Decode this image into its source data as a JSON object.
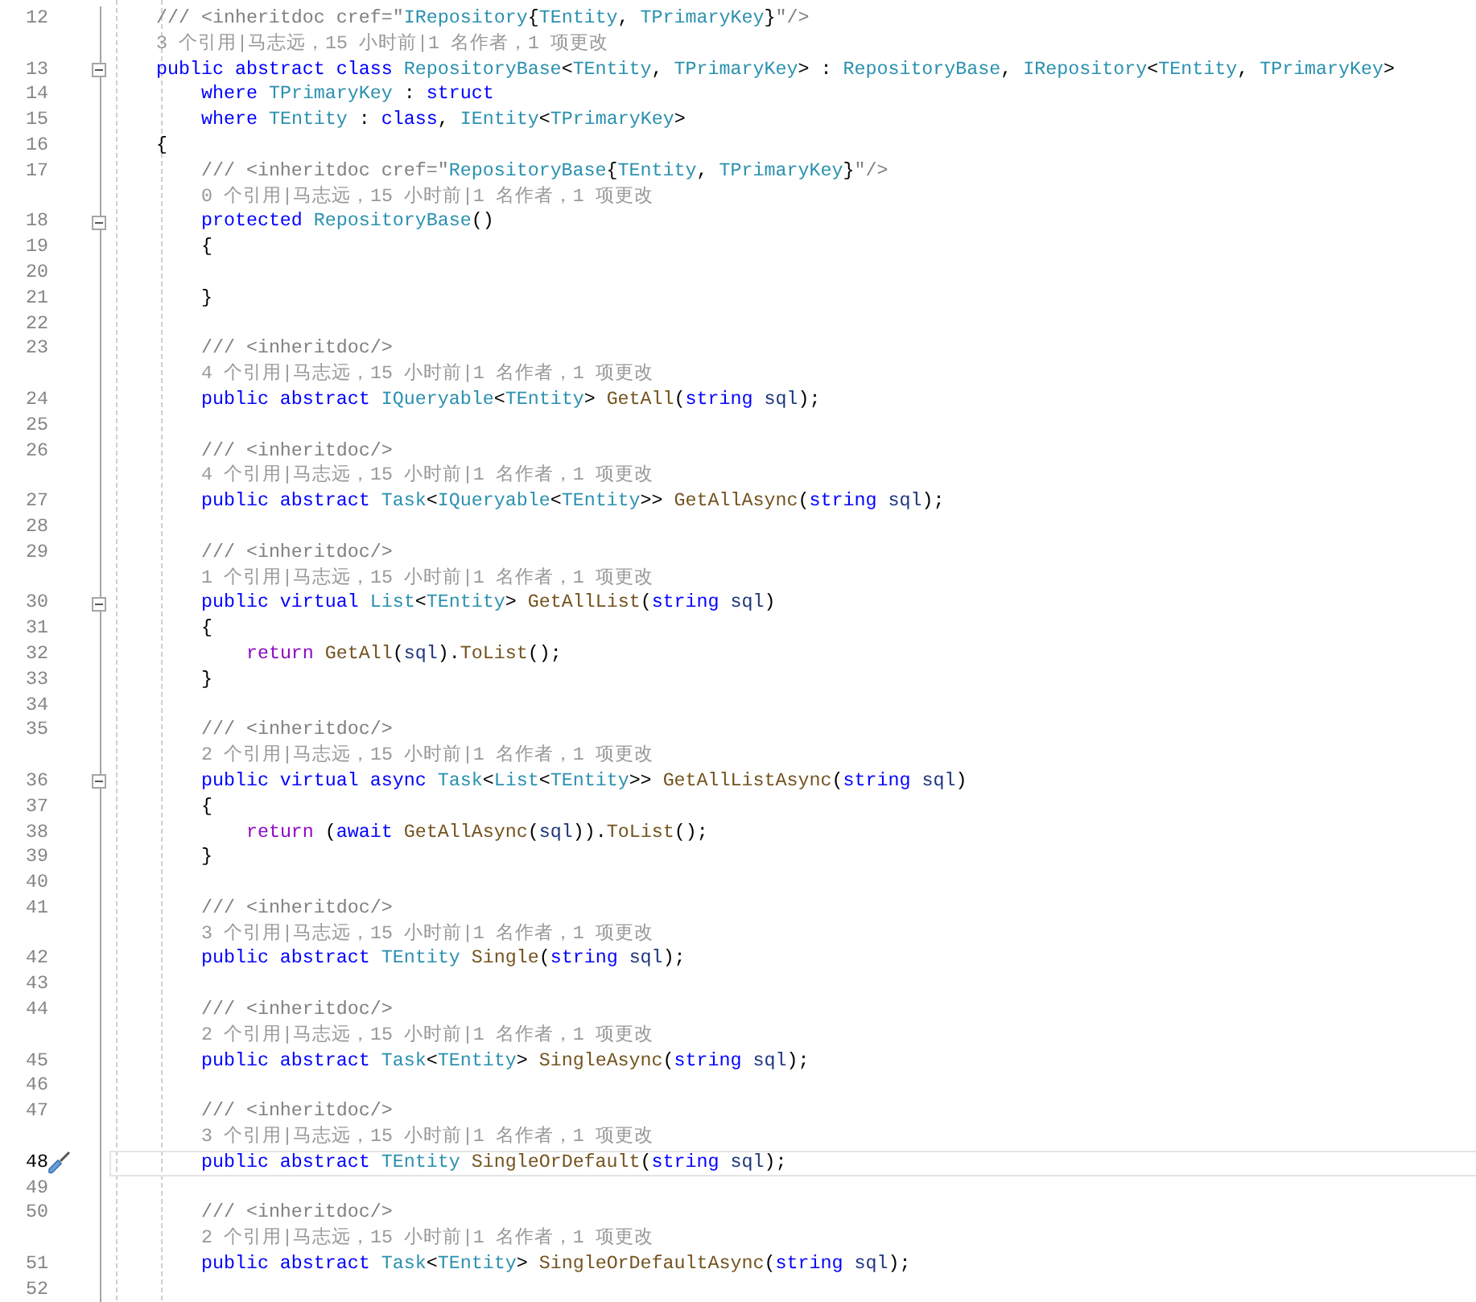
{
  "editor": {
    "rows": [
      {
        "kind": "code",
        "number": "12",
        "indent": "    ",
        "tokens": [
          {
            "text": "/// <inheritdoc cref=\"",
            "kind": "comment"
          },
          {
            "text": "IRepository",
            "kind": "type"
          },
          {
            "text": "{",
            "kind": "plain"
          },
          {
            "text": "TEntity",
            "kind": "type"
          },
          {
            "text": ", ",
            "kind": "plain"
          },
          {
            "text": "TPrimaryKey",
            "kind": "type"
          },
          {
            "text": "}",
            "kind": "plain"
          },
          {
            "text": "\"/>",
            "kind": "comment"
          }
        ]
      },
      {
        "kind": "lens",
        "indent": "    ",
        "text": "3 个引用|马志远，15 小时前|1 名作者，1 项更改"
      },
      {
        "kind": "code",
        "number": "13",
        "fold": true,
        "indent": "    ",
        "tokens": [
          {
            "text": "public abstract class ",
            "kind": "keyword"
          },
          {
            "text": "RepositoryBase",
            "kind": "type"
          },
          {
            "text": "<",
            "kind": "plain"
          },
          {
            "text": "TEntity",
            "kind": "type"
          },
          {
            "text": ", ",
            "kind": "plain"
          },
          {
            "text": "TPrimaryKey",
            "kind": "type"
          },
          {
            "text": "> : ",
            "kind": "plain"
          },
          {
            "text": "RepositoryBase",
            "kind": "type"
          },
          {
            "text": ", ",
            "kind": "plain"
          },
          {
            "text": "IRepository",
            "kind": "type"
          },
          {
            "text": "<",
            "kind": "plain"
          },
          {
            "text": "TEntity",
            "kind": "type"
          },
          {
            "text": ", ",
            "kind": "plain"
          },
          {
            "text": "TPrimaryKey",
            "kind": "type"
          },
          {
            "text": ">",
            "kind": "plain"
          }
        ]
      },
      {
        "kind": "code",
        "number": "14",
        "indent": "        ",
        "tokens": [
          {
            "text": "where ",
            "kind": "keyword"
          },
          {
            "text": "TPrimaryKey",
            "kind": "type"
          },
          {
            "text": " : ",
            "kind": "plain"
          },
          {
            "text": "struct",
            "kind": "keyword"
          }
        ]
      },
      {
        "kind": "code",
        "number": "15",
        "indent": "        ",
        "tokens": [
          {
            "text": "where ",
            "kind": "keyword"
          },
          {
            "text": "TEntity",
            "kind": "type"
          },
          {
            "text": " : ",
            "kind": "plain"
          },
          {
            "text": "class",
            "kind": "keyword"
          },
          {
            "text": ", ",
            "kind": "plain"
          },
          {
            "text": "IEntity",
            "kind": "type"
          },
          {
            "text": "<",
            "kind": "plain"
          },
          {
            "text": "TPrimaryKey",
            "kind": "type"
          },
          {
            "text": ">",
            "kind": "plain"
          }
        ]
      },
      {
        "kind": "code",
        "number": "16",
        "indent": "    ",
        "tokens": [
          {
            "text": "{",
            "kind": "plain"
          }
        ]
      },
      {
        "kind": "code",
        "number": "17",
        "indent": "        ",
        "tokens": [
          {
            "text": "/// <inheritdoc cref=\"",
            "kind": "comment"
          },
          {
            "text": "RepositoryBase",
            "kind": "type"
          },
          {
            "text": "{",
            "kind": "plain"
          },
          {
            "text": "TEntity",
            "kind": "type"
          },
          {
            "text": ", ",
            "kind": "plain"
          },
          {
            "text": "TPrimaryKey",
            "kind": "type"
          },
          {
            "text": "}",
            "kind": "plain"
          },
          {
            "text": "\"/>",
            "kind": "comment"
          }
        ]
      },
      {
        "kind": "lens",
        "indent": "        ",
        "text": "0 个引用|马志远，15 小时前|1 名作者，1 项更改"
      },
      {
        "kind": "code",
        "number": "18",
        "fold": true,
        "indent": "        ",
        "tokens": [
          {
            "text": "protected ",
            "kind": "keyword"
          },
          {
            "text": "RepositoryBase",
            "kind": "type"
          },
          {
            "text": "()",
            "kind": "plain"
          }
        ]
      },
      {
        "kind": "code",
        "number": "19",
        "indent": "        ",
        "tokens": [
          {
            "text": "{",
            "kind": "plain"
          }
        ]
      },
      {
        "kind": "code",
        "number": "20"
      },
      {
        "kind": "code",
        "number": "21",
        "indent": "        ",
        "tokens": [
          {
            "text": "}",
            "kind": "plain"
          }
        ]
      },
      {
        "kind": "code",
        "number": "22"
      },
      {
        "kind": "code",
        "number": "23",
        "indent": "        ",
        "tokens": [
          {
            "text": "/// <inheritdoc/>",
            "kind": "comment"
          }
        ]
      },
      {
        "kind": "lens",
        "indent": "        ",
        "text": "4 个引用|马志远，15 小时前|1 名作者，1 项更改"
      },
      {
        "kind": "code",
        "number": "24",
        "indent": "        ",
        "tokens": [
          {
            "text": "public abstract ",
            "kind": "keyword"
          },
          {
            "text": "IQueryable",
            "kind": "type"
          },
          {
            "text": "<",
            "kind": "plain"
          },
          {
            "text": "TEntity",
            "kind": "type"
          },
          {
            "text": "> ",
            "kind": "plain"
          },
          {
            "text": "GetAll",
            "kind": "method"
          },
          {
            "text": "(",
            "kind": "plain"
          },
          {
            "text": "string ",
            "kind": "keyword"
          },
          {
            "text": "sql",
            "kind": "param"
          },
          {
            "text": ");",
            "kind": "plain"
          }
        ]
      },
      {
        "kind": "code",
        "number": "25"
      },
      {
        "kind": "code",
        "number": "26",
        "indent": "        ",
        "tokens": [
          {
            "text": "/// <inheritdoc/>",
            "kind": "comment"
          }
        ]
      },
      {
        "kind": "lens",
        "indent": "        ",
        "text": "4 个引用|马志远，15 小时前|1 名作者，1 项更改"
      },
      {
        "kind": "code",
        "number": "27",
        "indent": "        ",
        "tokens": [
          {
            "text": "public abstract ",
            "kind": "keyword"
          },
          {
            "text": "Task",
            "kind": "type"
          },
          {
            "text": "<",
            "kind": "plain"
          },
          {
            "text": "IQueryable",
            "kind": "type"
          },
          {
            "text": "<",
            "kind": "plain"
          },
          {
            "text": "TEntity",
            "kind": "type"
          },
          {
            "text": ">> ",
            "kind": "plain"
          },
          {
            "text": "GetAllAsync",
            "kind": "method"
          },
          {
            "text": "(",
            "kind": "plain"
          },
          {
            "text": "string ",
            "kind": "keyword"
          },
          {
            "text": "sql",
            "kind": "param"
          },
          {
            "text": ");",
            "kind": "plain"
          }
        ]
      },
      {
        "kind": "code",
        "number": "28"
      },
      {
        "kind": "code",
        "number": "29",
        "indent": "        ",
        "tokens": [
          {
            "text": "/// <inheritdoc/>",
            "kind": "comment"
          }
        ]
      },
      {
        "kind": "lens",
        "indent": "        ",
        "text": "1 个引用|马志远，15 小时前|1 名作者，1 项更改"
      },
      {
        "kind": "code",
        "number": "30",
        "fold": true,
        "indent": "        ",
        "tokens": [
          {
            "text": "public virtual ",
            "kind": "keyword"
          },
          {
            "text": "List",
            "kind": "type"
          },
          {
            "text": "<",
            "kind": "plain"
          },
          {
            "text": "TEntity",
            "kind": "type"
          },
          {
            "text": "> ",
            "kind": "plain"
          },
          {
            "text": "GetAllList",
            "kind": "method"
          },
          {
            "text": "(",
            "kind": "plain"
          },
          {
            "text": "string ",
            "kind": "keyword"
          },
          {
            "text": "sql",
            "kind": "param"
          },
          {
            "text": ")",
            "kind": "plain"
          }
        ]
      },
      {
        "kind": "code",
        "number": "31",
        "indent": "        ",
        "tokens": [
          {
            "text": "{",
            "kind": "plain"
          }
        ]
      },
      {
        "kind": "code",
        "number": "32",
        "indent": "            ",
        "tokens": [
          {
            "text": "return ",
            "kind": "control"
          },
          {
            "text": "GetAll",
            "kind": "method"
          },
          {
            "text": "(",
            "kind": "plain"
          },
          {
            "text": "sql",
            "kind": "param"
          },
          {
            "text": ").",
            "kind": "plain"
          },
          {
            "text": "ToList",
            "kind": "method"
          },
          {
            "text": "();",
            "kind": "plain"
          }
        ]
      },
      {
        "kind": "code",
        "number": "33",
        "indent": "        ",
        "tokens": [
          {
            "text": "}",
            "kind": "plain"
          }
        ]
      },
      {
        "kind": "code",
        "number": "34"
      },
      {
        "kind": "code",
        "number": "35",
        "indent": "        ",
        "tokens": [
          {
            "text": "/// <inheritdoc/>",
            "kind": "comment"
          }
        ]
      },
      {
        "kind": "lens",
        "indent": "        ",
        "text": "2 个引用|马志远，15 小时前|1 名作者，1 项更改"
      },
      {
        "kind": "code",
        "number": "36",
        "fold": true,
        "indent": "        ",
        "tokens": [
          {
            "text": "public virtual async ",
            "kind": "keyword"
          },
          {
            "text": "Task",
            "kind": "type"
          },
          {
            "text": "<",
            "kind": "plain"
          },
          {
            "text": "List",
            "kind": "type"
          },
          {
            "text": "<",
            "kind": "plain"
          },
          {
            "text": "TEntity",
            "kind": "type"
          },
          {
            "text": ">> ",
            "kind": "plain"
          },
          {
            "text": "GetAllListAsync",
            "kind": "method"
          },
          {
            "text": "(",
            "kind": "plain"
          },
          {
            "text": "string ",
            "kind": "keyword"
          },
          {
            "text": "sql",
            "kind": "param"
          },
          {
            "text": ")",
            "kind": "plain"
          }
        ]
      },
      {
        "kind": "code",
        "number": "37",
        "indent": "        ",
        "tokens": [
          {
            "text": "{",
            "kind": "plain"
          }
        ]
      },
      {
        "kind": "code",
        "number": "38",
        "indent": "            ",
        "tokens": [
          {
            "text": "return ",
            "kind": "control"
          },
          {
            "text": "(",
            "kind": "plain"
          },
          {
            "text": "await ",
            "kind": "keyword"
          },
          {
            "text": "GetAllAsync",
            "kind": "method"
          },
          {
            "text": "(",
            "kind": "plain"
          },
          {
            "text": "sql",
            "kind": "param"
          },
          {
            "text": ")).",
            "kind": "plain"
          },
          {
            "text": "ToList",
            "kind": "method"
          },
          {
            "text": "();",
            "kind": "plain"
          }
        ]
      },
      {
        "kind": "code",
        "number": "39",
        "indent": "        ",
        "tokens": [
          {
            "text": "}",
            "kind": "plain"
          }
        ]
      },
      {
        "kind": "code",
        "number": "40"
      },
      {
        "kind": "code",
        "number": "41",
        "indent": "        ",
        "tokens": [
          {
            "text": "/// <inheritdoc/>",
            "kind": "comment"
          }
        ]
      },
      {
        "kind": "lens",
        "indent": "        ",
        "text": "3 个引用|马志远，15 小时前|1 名作者，1 项更改"
      },
      {
        "kind": "code",
        "number": "42",
        "indent": "        ",
        "tokens": [
          {
            "text": "public abstract ",
            "kind": "keyword"
          },
          {
            "text": "TEntity ",
            "kind": "type"
          },
          {
            "text": "Single",
            "kind": "method"
          },
          {
            "text": "(",
            "kind": "plain"
          },
          {
            "text": "string ",
            "kind": "keyword"
          },
          {
            "text": "sql",
            "kind": "param"
          },
          {
            "text": ");",
            "kind": "plain"
          }
        ]
      },
      {
        "kind": "code",
        "number": "43"
      },
      {
        "kind": "code",
        "number": "44",
        "indent": "        ",
        "tokens": [
          {
            "text": "/// <inheritdoc/>",
            "kind": "comment"
          }
        ]
      },
      {
        "kind": "lens",
        "indent": "        ",
        "text": "2 个引用|马志远，15 小时前|1 名作者，1 项更改"
      },
      {
        "kind": "code",
        "number": "45",
        "indent": "        ",
        "tokens": [
          {
            "text": "public abstract ",
            "kind": "keyword"
          },
          {
            "text": "Task",
            "kind": "type"
          },
          {
            "text": "<",
            "kind": "plain"
          },
          {
            "text": "TEntity",
            "kind": "type"
          },
          {
            "text": "> ",
            "kind": "plain"
          },
          {
            "text": "SingleAsync",
            "kind": "method"
          },
          {
            "text": "(",
            "kind": "plain"
          },
          {
            "text": "string ",
            "kind": "keyword"
          },
          {
            "text": "sql",
            "kind": "param"
          },
          {
            "text": ");",
            "kind": "plain"
          }
        ]
      },
      {
        "kind": "code",
        "number": "46"
      },
      {
        "kind": "code",
        "number": "47",
        "indent": "        ",
        "tokens": [
          {
            "text": "/// <inheritdoc/>",
            "kind": "comment"
          }
        ]
      },
      {
        "kind": "lens",
        "indent": "        ",
        "text": "3 个引用|马志远，15 小时前|1 名作者，1 项更改"
      },
      {
        "kind": "code",
        "number": "48",
        "current": true,
        "indent": "        ",
        "tokens": [
          {
            "text": "public abstract ",
            "kind": "keyword"
          },
          {
            "text": "TEntity ",
            "kind": "type"
          },
          {
            "text": "SingleOrDefault",
            "kind": "method"
          },
          {
            "text": "(",
            "kind": "plain"
          },
          {
            "text": "string ",
            "kind": "keyword"
          },
          {
            "text": "sql",
            "kind": "param"
          },
          {
            "text": ");",
            "kind": "plain"
          }
        ]
      },
      {
        "kind": "code",
        "number": "49"
      },
      {
        "kind": "code",
        "number": "50",
        "indent": "        ",
        "tokens": [
          {
            "text": "/// <inheritdoc/>",
            "kind": "comment"
          }
        ]
      },
      {
        "kind": "lens",
        "indent": "        ",
        "text": "2 个引用|马志远，15 小时前|1 名作者，1 项更改"
      },
      {
        "kind": "code",
        "number": "51",
        "indent": "        ",
        "tokens": [
          {
            "text": "public abstract ",
            "kind": "keyword"
          },
          {
            "text": "Task",
            "kind": "type"
          },
          {
            "text": "<",
            "kind": "plain"
          },
          {
            "text": "TEntity",
            "kind": "type"
          },
          {
            "text": "> ",
            "kind": "plain"
          },
          {
            "text": "SingleOrDefaultAsync",
            "kind": "method"
          },
          {
            "text": "(",
            "kind": "plain"
          },
          {
            "text": "string ",
            "kind": "keyword"
          },
          {
            "text": "sql",
            "kind": "param"
          },
          {
            "text": ");",
            "kind": "plain"
          }
        ]
      },
      {
        "kind": "code",
        "number": "52"
      }
    ]
  }
}
